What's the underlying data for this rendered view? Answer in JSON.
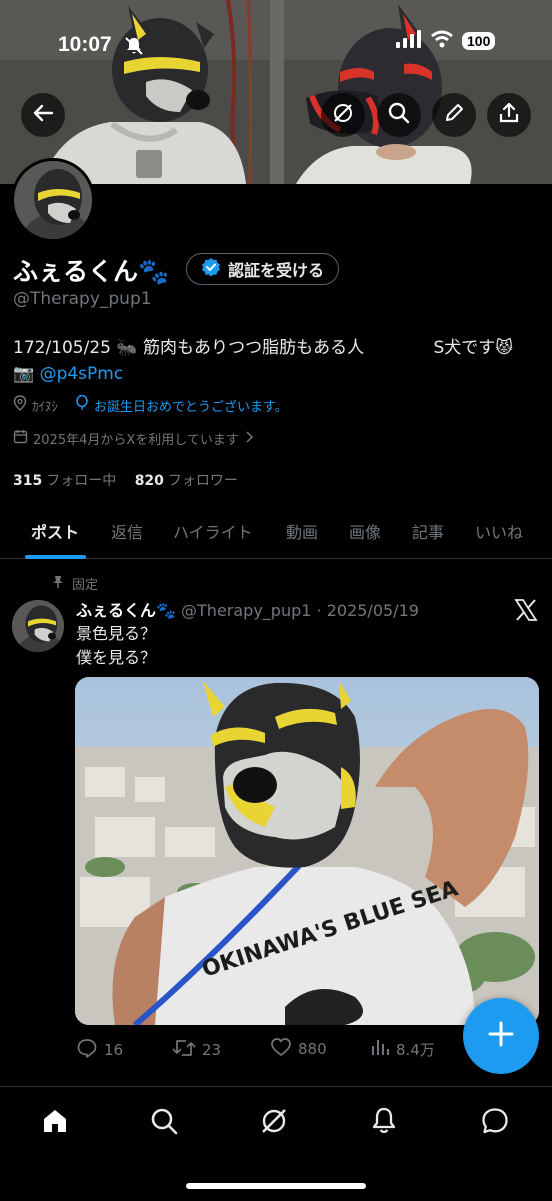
{
  "status_bar": {
    "time": "10:07",
    "battery": "100"
  },
  "profile": {
    "display_name": "ふぇるくん🐾",
    "verify_button_label": "認証を受ける",
    "handle": "@Therapy_pup1",
    "bio_line1": "172/105/25 🐜 筋肉もありつつ脂肪もある人",
    "bio_line1_right": "S犬です😾",
    "bio_line2_prefix": "📷 ",
    "bio_link": "@p4sPmc",
    "location": "ｶｲﾇｼ",
    "birthday": "お誕生日おめでとうございます。",
    "joined": "2025年4月からXを利用しています",
    "following_count": "315",
    "following_label": "フォロー中",
    "followers_count": "820",
    "followers_label": "フォロワー"
  },
  "tabs": [
    "ポスト",
    "返信",
    "ハイライト",
    "動画",
    "画像",
    "記事",
    "いいね"
  ],
  "active_tab": "ポスト",
  "pinned_post": {
    "pinned_label": "固定",
    "author_name": "ふぇるくん🐾",
    "author_handle": "@Therapy_pup1",
    "date": "· 2025/05/19",
    "text_line1": "景色見る？",
    "text_line2": "僕を見る？",
    "image_shirt_text": "OKINAWA'S BLUE SEA",
    "replies": "16",
    "reposts": "23",
    "likes": "880",
    "views": "8.4万"
  },
  "icons": {
    "back": "back-arrow-icon",
    "grok": "grok-icon",
    "search": "search-icon",
    "edit": "edit-pencil-icon",
    "share": "share-icon",
    "x_logo": "x-logo-icon",
    "compose": "plus-icon"
  },
  "colors": {
    "accent": "#1d9bf0",
    "background": "#000000",
    "muted": "#71767b"
  }
}
